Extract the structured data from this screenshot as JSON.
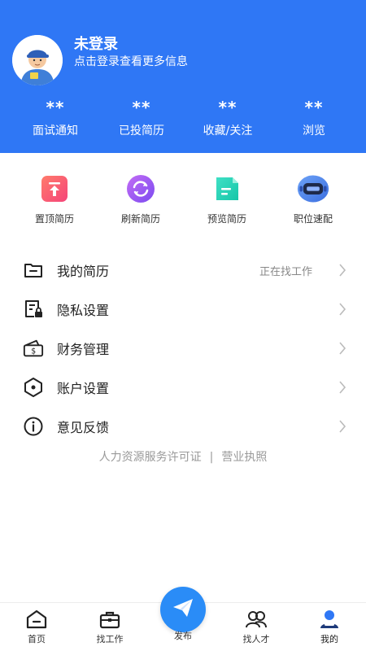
{
  "header": {
    "title": "未登录",
    "subtitle": "点击登录查看更多信息",
    "bg_color": "#2F77F5"
  },
  "stats": [
    {
      "value": "**",
      "label": "面试通知"
    },
    {
      "value": "**",
      "label": "已投简历"
    },
    {
      "value": "**",
      "label": "收藏/关注"
    },
    {
      "value": "**",
      "label": "浏览"
    }
  ],
  "quick_actions": [
    {
      "label": "置顶简历",
      "icon": "pin-top-icon"
    },
    {
      "label": "刷新简历",
      "icon": "refresh-icon"
    },
    {
      "label": "预览简历",
      "icon": "document-icon"
    },
    {
      "label": "职位速配",
      "icon": "robot-icon"
    }
  ],
  "menu": [
    {
      "label": "我的简历",
      "extra": "正在找工作",
      "icon": "folder-icon"
    },
    {
      "label": "隐私设置",
      "extra": "",
      "icon": "privacy-lock-icon"
    },
    {
      "label": "财务管理",
      "extra": "",
      "icon": "wallet-icon"
    },
    {
      "label": "账户设置",
      "extra": "",
      "icon": "hexagon-settings-icon"
    },
    {
      "label": "意见反馈",
      "extra": "",
      "icon": "info-icon"
    }
  ],
  "footer": {
    "license": "人力资源服务许可证",
    "separator": "|",
    "business": "营业执照"
  },
  "bottom_nav": [
    {
      "label": "首页",
      "icon": "home-icon"
    },
    {
      "label": "找工作",
      "icon": "briefcase-icon"
    },
    {
      "label": "发布",
      "icon": "paper-plane-icon"
    },
    {
      "label": "找人才",
      "icon": "people-icon"
    },
    {
      "label": "我的",
      "icon": "profile-icon"
    }
  ]
}
